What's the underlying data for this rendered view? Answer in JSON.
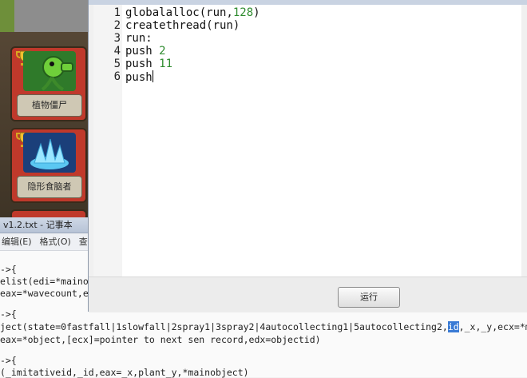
{
  "editor": {
    "lines": [
      {
        "n": "1",
        "text": "globalalloc(run,",
        "num": "128",
        "tail": ")"
      },
      {
        "n": "2",
        "text": "createthread(run)",
        "num": "",
        "tail": ""
      },
      {
        "n": "3",
        "text": "run:",
        "num": "",
        "tail": ""
      },
      {
        "n": "4",
        "text": "push ",
        "num": "2",
        "tail": ""
      },
      {
        "n": "5",
        "text": "push ",
        "num": "11",
        "tail": ""
      },
      {
        "n": "6",
        "text": "push",
        "num": "",
        "tail": ""
      }
    ],
    "run_button": "运行"
  },
  "notepad": {
    "title": "v1.2.txt - 记事本",
    "menu": [
      "编辑(E)",
      "格式(O)",
      "查看("
    ],
    "lines": [
      "->{",
      "elist(edi=*mainob",
      "eax=*wavecount,e",
      "->{",
      "ject(state=0fastfall|1slowfall|2spray1|3spray2|4autocollecting1|5autocollecting2,",
      "eax=*object,[ecx]=pointer to next sen record,edx=objectid)",
      "->{",
      "(_imitativeid,_id,eax=_x,plant_y,*mainobject)"
    ],
    "line5_selected": "id",
    "line5_tail": ",_x,_y,ecx=*ma"
  },
  "game": {
    "cards": [
      {
        "label": "植物僵尸",
        "icon": "peashooter-icon"
      },
      {
        "label": "隐形食脑者",
        "icon": "ice-splash-icon"
      }
    ]
  },
  "colors": {
    "number": "#2e8b2e",
    "selection": "#3a7bd5",
    "card": "#c0392b"
  }
}
